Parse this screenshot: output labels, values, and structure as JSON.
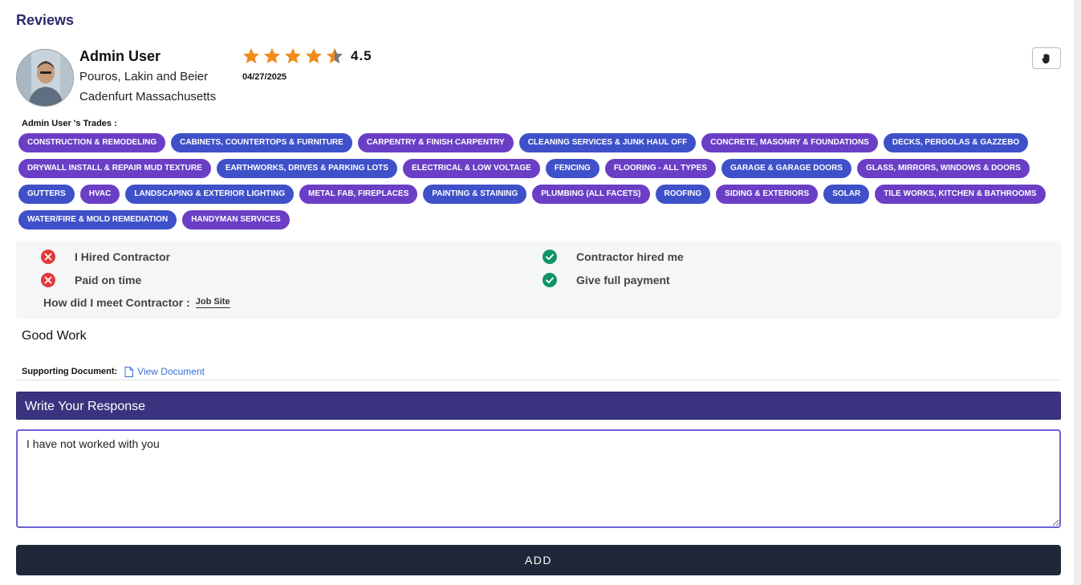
{
  "section_title": "Reviews",
  "reviewer": {
    "name": "Admin User",
    "company": "Pouros, Lakin and Beier",
    "location": "Cadenfurt Massachusetts"
  },
  "rating": {
    "value": "4.5",
    "stars_filled": 4.5,
    "max": 5,
    "star_color": "#f08c1e"
  },
  "review_date": "04/27/2025",
  "flag_button": {
    "icon": "hand-stop-icon"
  },
  "trades_title": "Admin User 's Trades :",
  "trades": [
    {
      "label": "CONSTRUCTION & REMODELING",
      "color": "purple"
    },
    {
      "label": "CABINETS, COUNTERTOPS & FURNITURE",
      "color": "blue"
    },
    {
      "label": "CARPENTRY & FINISH CARPENTRY",
      "color": "purple"
    },
    {
      "label": "CLEANING SERVICES & JUNK HAUL OFF",
      "color": "blue"
    },
    {
      "label": "CONCRETE, MASONRY & FOUNDATIONS",
      "color": "purple"
    },
    {
      "label": "DECKS, PERGOLAS & GAZZEBO",
      "color": "blue"
    },
    {
      "label": "DRYWALL INSTALL & REPAIR MUD TEXTURE",
      "color": "purple"
    },
    {
      "label": "EARTHWORKS, DRIVES & PARKING LOTS",
      "color": "blue"
    },
    {
      "label": "ELECTRICAL & LOW VOLTAGE",
      "color": "purple"
    },
    {
      "label": "FENCING",
      "color": "blue"
    },
    {
      "label": "FLOORING - ALL TYPES",
      "color": "purple"
    },
    {
      "label": "GARAGE & GARAGE DOORS",
      "color": "blue"
    },
    {
      "label": "GLASS, MIRRORS, WINDOWS & DOORS",
      "color": "purple"
    },
    {
      "label": "GUTTERS",
      "color": "blue"
    },
    {
      "label": "HVAC",
      "color": "purple"
    },
    {
      "label": "LANDSCAPING & EXTERIOR LIGHTING",
      "color": "blue"
    },
    {
      "label": "METAL FAB, FIREPLACES",
      "color": "purple"
    },
    {
      "label": "PAINTING & STAINING",
      "color": "blue"
    },
    {
      "label": "PLUMBING (ALL FACETS)",
      "color": "purple"
    },
    {
      "label": "ROOFING",
      "color": "blue"
    },
    {
      "label": "SIDING & EXTERIORS",
      "color": "purple"
    },
    {
      "label": "SOLAR",
      "color": "blue"
    },
    {
      "label": "TILE WORKS, KITCHEN & BATHROOMS",
      "color": "purple"
    },
    {
      "label": "WATER/FIRE & MOLD REMEDIATION",
      "color": "blue"
    },
    {
      "label": "HANDYMAN SERVICES",
      "color": "purple"
    }
  ],
  "status": {
    "hired_contractor": {
      "label": "I Hired Contractor",
      "value": false
    },
    "contractor_hired_me": {
      "label": "Contractor hired me",
      "value": true
    },
    "paid_on_time": {
      "label": "Paid on time",
      "value": false
    },
    "give_full_payment": {
      "label": "Give full payment",
      "value": true
    },
    "meet_label": "How did I meet Contractor :",
    "meet_value": "Job Site"
  },
  "comment": "Good Work",
  "supporting_document": {
    "label": "Supporting Document:",
    "link": "View Document"
  },
  "response": {
    "header": "Write Your Response",
    "value": "I have not worked with you"
  },
  "add_button": "ADD",
  "colors": {
    "false_icon": "#e03a3a",
    "true_icon": "#12936a",
    "header_bg": "#3a3480",
    "button_bg": "#1f2738"
  }
}
